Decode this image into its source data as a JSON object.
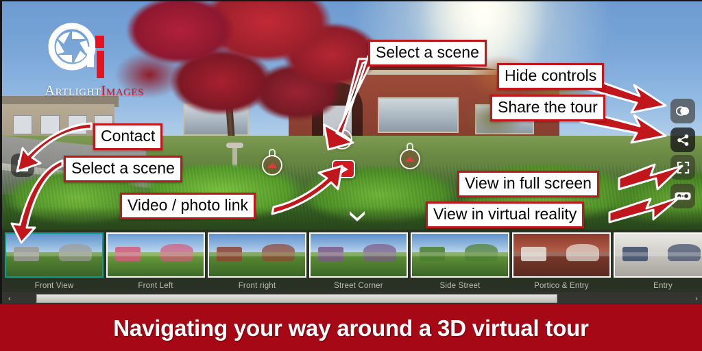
{
  "banner": {
    "text": "Navigating your way around a 3D virtual tour",
    "background_color": "#a60915",
    "text_color": "#ffffff"
  },
  "logo": {
    "name_primary": "Artlight",
    "name_secondary": "Images",
    "icon": "camera-aperture-icon",
    "primary_color": "#ffffff",
    "secondary_color": "#e8121f"
  },
  "callouts": [
    {
      "id": "select-scene-top",
      "label": "Select a scene",
      "points_to": "hotspot-door"
    },
    {
      "id": "hide-controls",
      "label": "Hide controls",
      "points_to": "control-hide"
    },
    {
      "id": "share-tour",
      "label": "Share the tour",
      "points_to": "control-share"
    },
    {
      "id": "contact",
      "label": "Contact",
      "points_to": "contact-button"
    },
    {
      "id": "select-scene-left",
      "label": "Select a scene",
      "points_to": "thumbnail-strip"
    },
    {
      "id": "video-photo-link",
      "label": "Video / photo link",
      "points_to": "video-hotspot"
    },
    {
      "id": "full-screen",
      "label": "View in full screen",
      "points_to": "control-fullscreen"
    },
    {
      "id": "virtual-reality",
      "label": "View in virtual reality",
      "points_to": "control-vr"
    }
  ],
  "controls": [
    {
      "id": "hide",
      "icon": "hide-controls-icon",
      "tooltip": "Hide controls"
    },
    {
      "id": "share",
      "icon": "share-icon",
      "tooltip": "Share the tour"
    },
    {
      "id": "fullscreen",
      "icon": "fullscreen-icon",
      "tooltip": "View in full screen"
    },
    {
      "id": "vr",
      "icon": "vr-goggles-icon",
      "tooltip": "View in virtual reality"
    }
  ],
  "contact_button": {
    "icon": "contact-card-icon",
    "tooltip": "Contact"
  },
  "hotspots": [
    {
      "id": "door",
      "icon": "scene-link-icon",
      "label": "Select a scene"
    },
    {
      "id": "left",
      "icon": "scene-link-icon",
      "label": "Select a scene"
    },
    {
      "id": "right",
      "icon": "scene-link-icon",
      "label": "Select a scene"
    }
  ],
  "video_hotspot": {
    "icon": "play-icon",
    "label": "Video / photo link"
  },
  "chevron_down": {
    "icon": "chevron-down-icon"
  },
  "thumbnails": {
    "selected_index": 0,
    "selected_border_color": "#0b9e8e",
    "items": [
      {
        "label": "Front View"
      },
      {
        "label": "Front Left"
      },
      {
        "label": "Front right"
      },
      {
        "label": "Street Corner"
      },
      {
        "label": "Side Street"
      },
      {
        "label": "Portico & Entry"
      },
      {
        "label": "Entry"
      }
    ]
  },
  "scrollbar": {
    "left_arrow": "‹",
    "right_arrow": "›"
  }
}
